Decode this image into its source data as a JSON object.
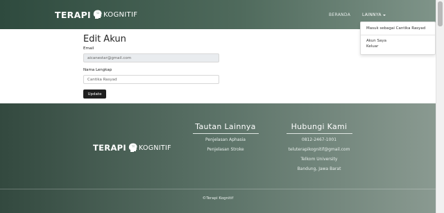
{
  "navbar": {
    "brand_left": "TERAPI",
    "brand_right": "KOGNITIF",
    "links": {
      "beranda": "BERANDA",
      "lainnya": "LAINNYA"
    }
  },
  "dropdown": {
    "items": [
      "Masuk sebagai Cantika Rasyad",
      "Akun Saya",
      "Keluar"
    ]
  },
  "form": {
    "title": "Edit Akun",
    "email_label": "Email",
    "email_value": "aicanestar@gmail.com",
    "nama_label": "Nama Lengkap",
    "nama_value": "Cantika Rasyad",
    "update_label": "Update"
  },
  "footer": {
    "brand_left": "TERAPI",
    "brand_right": "KOGNITIF",
    "tautan": {
      "title": "Tautan Lainnya",
      "links": [
        "Penjelasan Aphasia",
        "Penjelasan Stroke"
      ]
    },
    "hubungi": {
      "title": "Hubungi Kami",
      "lines": [
        "0812-2467-1001",
        "teluterapikognitif@gmail.com",
        "Telkom University",
        "Bandung, Jawa Barat"
      ]
    },
    "copyright": "©Terapi Kognitif"
  },
  "colors": {
    "navbar_dark": "#2e4a3e",
    "navbar_light": "#7f9489",
    "footer_dark": "#33493f",
    "button": "#1f1f1f"
  }
}
